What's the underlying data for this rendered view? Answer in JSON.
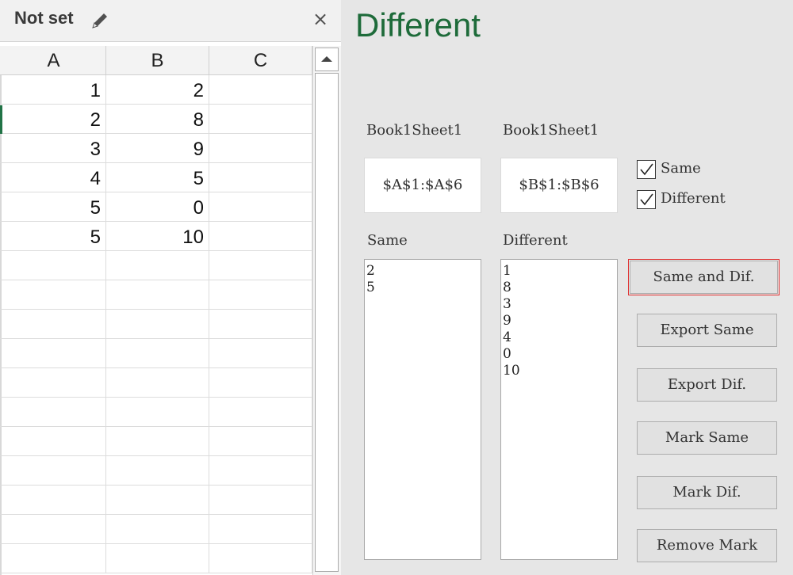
{
  "sheet_pane": {
    "title": "Not set",
    "pencil_icon": "pencil-icon",
    "close_icon": "close-icon",
    "close_glyph": "×",
    "columns": [
      "A",
      "B",
      "C"
    ],
    "rows": [
      [
        "1",
        "2",
        ""
      ],
      [
        "2",
        "8",
        ""
      ],
      [
        "3",
        "9",
        ""
      ],
      [
        "4",
        "5",
        ""
      ],
      [
        "5",
        "0",
        ""
      ],
      [
        "5",
        "10",
        ""
      ]
    ],
    "accent_color": "#217346"
  },
  "dialog": {
    "title": "Different",
    "title_color": "#1e6b3a",
    "range1_label": "Book1Sheet1",
    "range2_label": "Book1Sheet1",
    "range1_value": "$A$1:$A$6",
    "range2_value": "$B$1:$B$6",
    "check_same_label": "Same",
    "check_same_checked": true,
    "check_diff_label": "Different",
    "check_diff_checked": true,
    "same_list_label": "Same",
    "diff_list_label": "Different",
    "same_items": [
      "2",
      "5"
    ],
    "diff_items": [
      "1",
      "8",
      "3",
      "9",
      "4",
      "0",
      "10"
    ],
    "buttons": {
      "same_and_dif": "Same and Dif.",
      "export_same": "Export Same",
      "export_dif": "Export Dif.",
      "mark_same": "Mark Same",
      "mark_dif": "Mark Dif.",
      "remove_mark": "Remove Mark"
    },
    "highlight_color": "#e03030"
  }
}
